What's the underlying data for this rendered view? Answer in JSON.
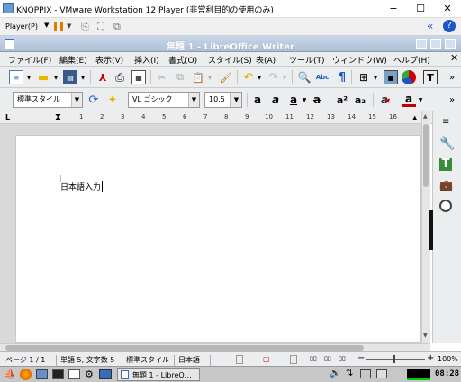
{
  "vm": {
    "title": "KNOPPIX - VMware Workstation 12 Player (非営利目的の使用のみ)",
    "player_menu": "Player(P)",
    "controls": {
      "minimize": "−",
      "maximize": "☐",
      "close": "✕"
    }
  },
  "writer": {
    "title": "無題 1 - LibreOffice Writer",
    "menu": [
      "ファイル(F)",
      "編集(E)",
      "表示(V)",
      "挿入(I)",
      "書式(O)",
      "スタイル(S)",
      "表(A)",
      "ツール(T)",
      "ウィンドウ(W)",
      "ヘルプ(H)"
    ],
    "para_style": "標準スタイル",
    "font_name": "VL ゴシック",
    "font_size": "10.5",
    "ruler_ticks": [
      "1",
      "2",
      "3",
      "4",
      "5",
      "6",
      "7",
      "8",
      "9",
      "10",
      "11",
      "12",
      "13",
      "14",
      "15",
      "16"
    ],
    "document_text": "日本語入力"
  },
  "status": {
    "page": "ページ 1 / 1",
    "words": "単語 5, 文字数 5",
    "style": "標準スタイル",
    "language": "日本語",
    "zoom": "100%"
  },
  "taskbar": {
    "window_label": "無題 1 - LibreO…",
    "clock": "08:28"
  },
  "colors": {
    "accent": "#1a56c4",
    "highlight": "#e6b800",
    "font_color": "#c00000"
  }
}
